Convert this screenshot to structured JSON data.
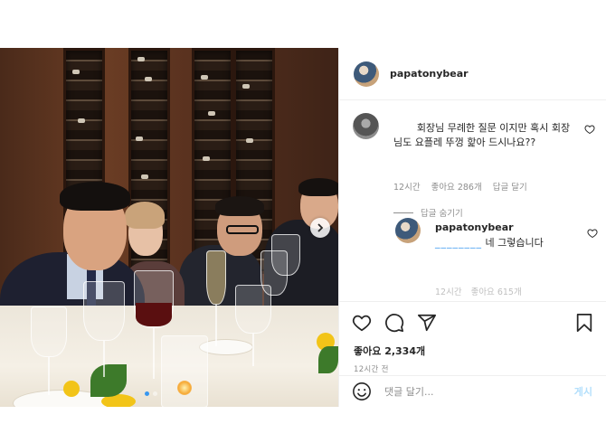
{
  "header": {
    "username": "papatonybear",
    "avatar_icon": "profile-avatar-icon"
  },
  "comment": {
    "text": "회장님 무례한 질문 이지만 혹시 회장님도 요플레 뚜껑 핥아 드시나요??",
    "time": "12시간",
    "likes": "좋아요 286개",
    "reply_label": "답글 달기",
    "hide_replies": "답글 숨기기"
  },
  "reply": {
    "username": "papatonybear",
    "mention": "________",
    "text": "네 그렇습니다",
    "meta_time": "12시간",
    "meta_likes": "좋아요 615개"
  },
  "actions": {
    "icons": [
      "heart-icon",
      "comment-icon",
      "share-icon",
      "bookmark-icon"
    ],
    "likes": "좋아요 2,334개",
    "time": "12시간 전"
  },
  "add_comment": {
    "placeholder": "댓글 달기...",
    "post_label": "게시"
  },
  "colors": {
    "text": "#262626",
    "secondary": "#8e8e8e",
    "accent": "#3897f0",
    "post_disabled": "#b2dffc",
    "border": "#efefef"
  }
}
